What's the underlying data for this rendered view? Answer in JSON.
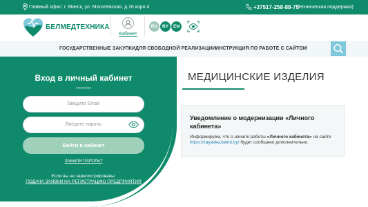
{
  "topbar": {
    "address": "Главный офис: г. Минск, ул. Могилевская, д.16 корп.4",
    "phone": "+37517-258-88-75",
    "phone_note": "(Техническая поддержка)"
  },
  "header": {
    "logo_text": "БЕЛМЕДТЕХНИКА",
    "cabinet_label": "Кабинет",
    "languages": [
      "RU",
      "BY",
      "EN"
    ]
  },
  "nav": {
    "items": [
      "ГОСУДАРСТВЕННЫЕ ЗАКУПКИ",
      "ДЛЯ СВОБОДНОЙ РЕАЛИЗАЦИИ",
      "ИНСТРУКЦИЯ ПО РАБОТЕ С САЙТОМ"
    ]
  },
  "login": {
    "title": "Вход в личный кабинет",
    "email_placeholder": "Введите Email",
    "password_placeholder": "Введите пароль",
    "submit_label": "Войти в кабинет",
    "forgot_label": "ЗАБЫЛИ ПАРОЛЬ?",
    "not_registered": "Если вы не зарегистрированы:",
    "register_link": "ПОДАЧА ЗАЯВКИ НА РЕГИСТРАЦИЮ ПРЕДПРИЯТИЯ"
  },
  "main": {
    "title": "МЕДИЦИНСКИЕ ИЗДЕЛИЯ",
    "notice_title": "Уведомление о модернизации «Личного кабинета»",
    "notice_text_1": "Информируем, что о начале работы ",
    "notice_text_bold": "«Личного кабинета»",
    "notice_text_2": " на сайте ",
    "notice_link": "https://zayavka.belmt.by/",
    "notice_text_3": " будет сообщено дополнительно."
  },
  "colors": {
    "brand_green": "#0f8a6b",
    "light_green": "#9fd0ba",
    "search_blue": "#7fc7da"
  }
}
